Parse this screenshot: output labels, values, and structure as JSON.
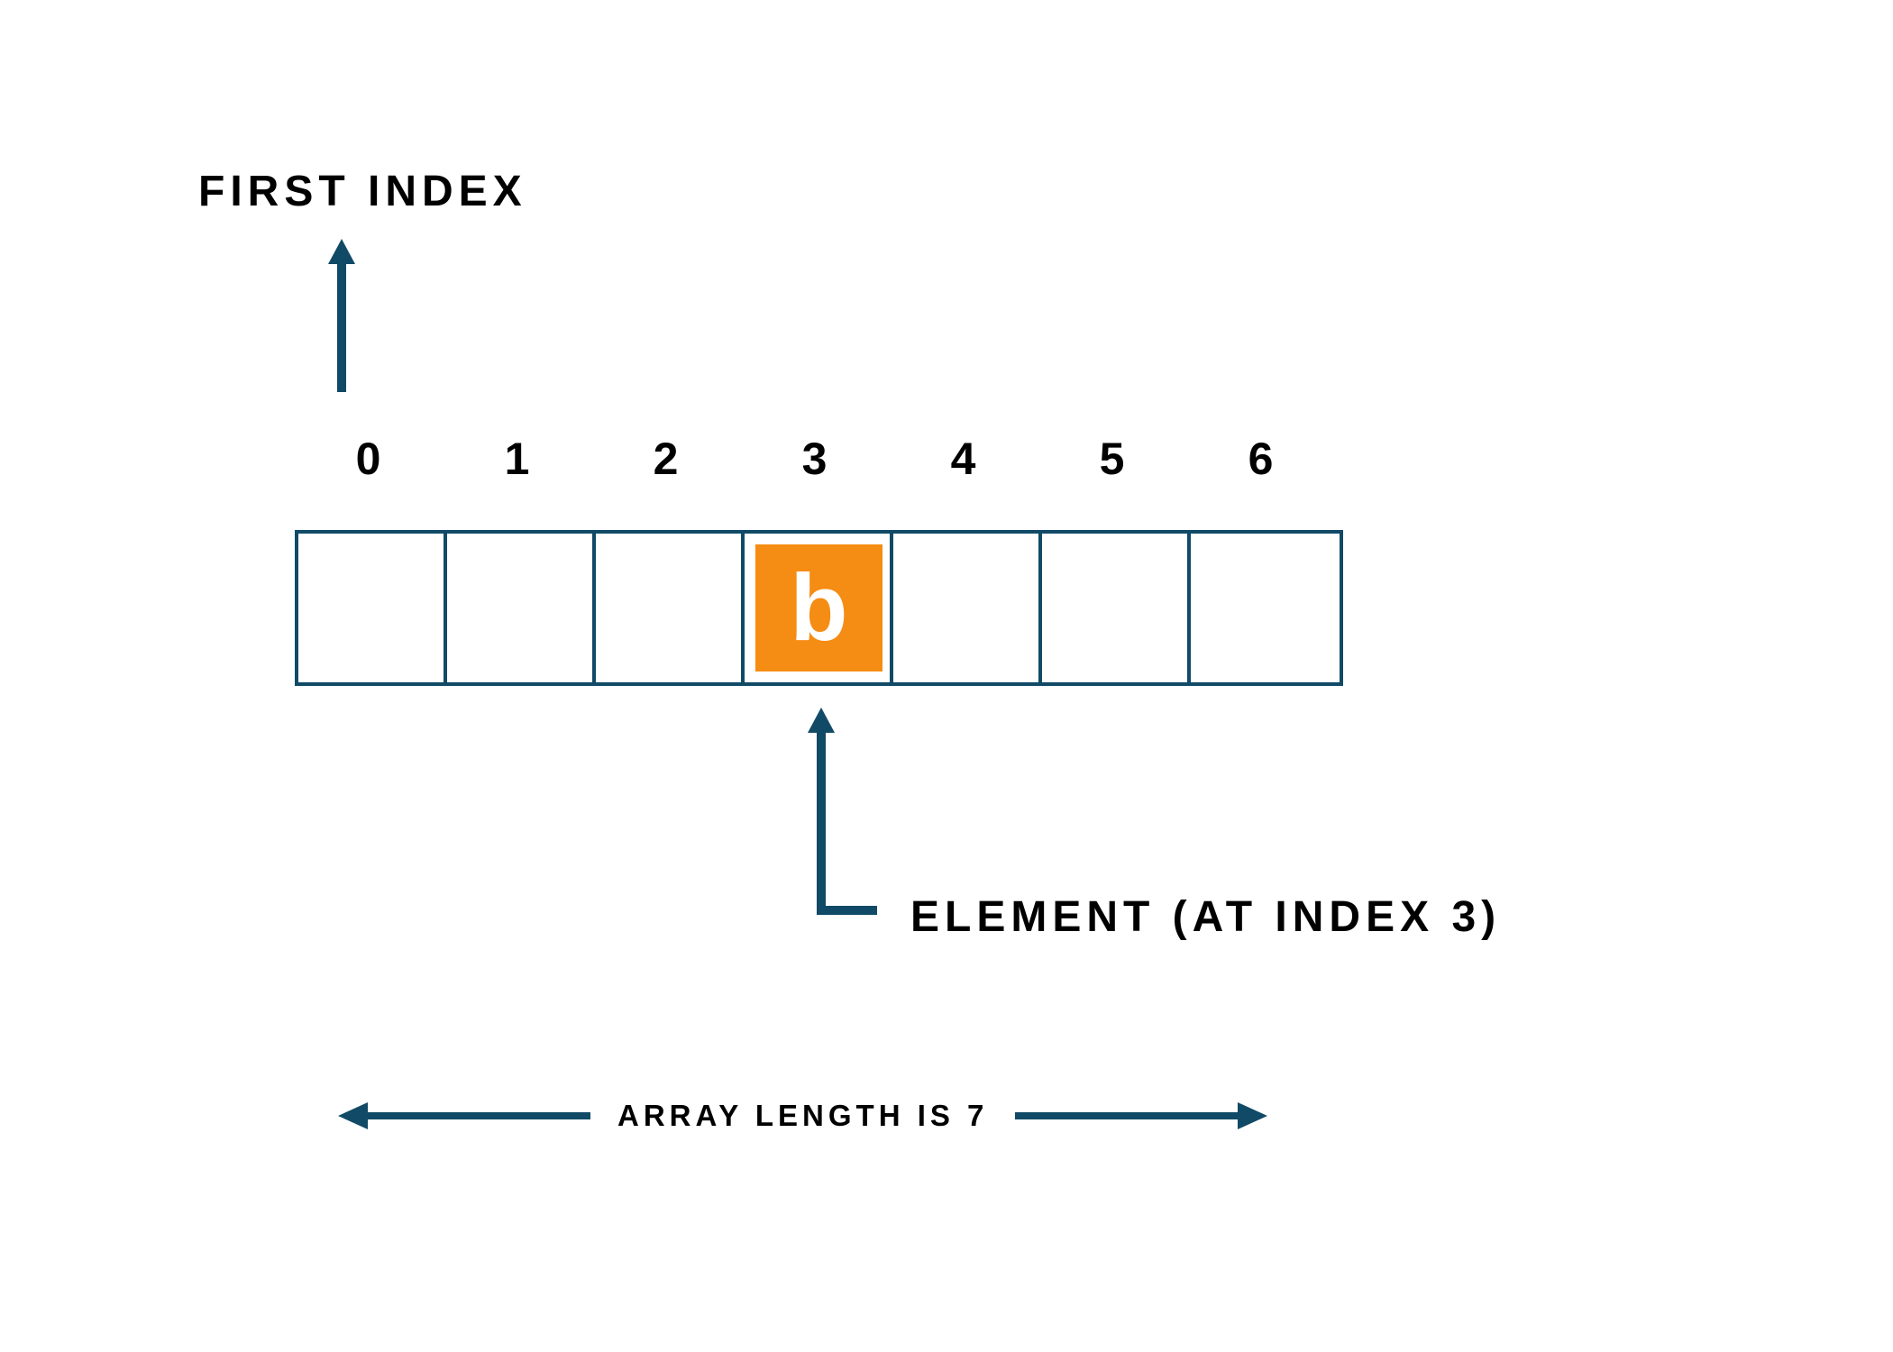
{
  "labels": {
    "first_index": "FIRST INDEX",
    "element_at": "ELEMENT (AT INDEX 3)",
    "array_length": "ARRAY LENGTH IS 7"
  },
  "array": {
    "indices": [
      "0",
      "1",
      "2",
      "3",
      "4",
      "5",
      "6"
    ],
    "highlighted_index": 3,
    "highlighted_value": "b",
    "length": 7
  },
  "colors": {
    "border": "#114a66",
    "highlight": "#f58c14",
    "text": "#000000",
    "highlight_text": "#ffffff"
  }
}
